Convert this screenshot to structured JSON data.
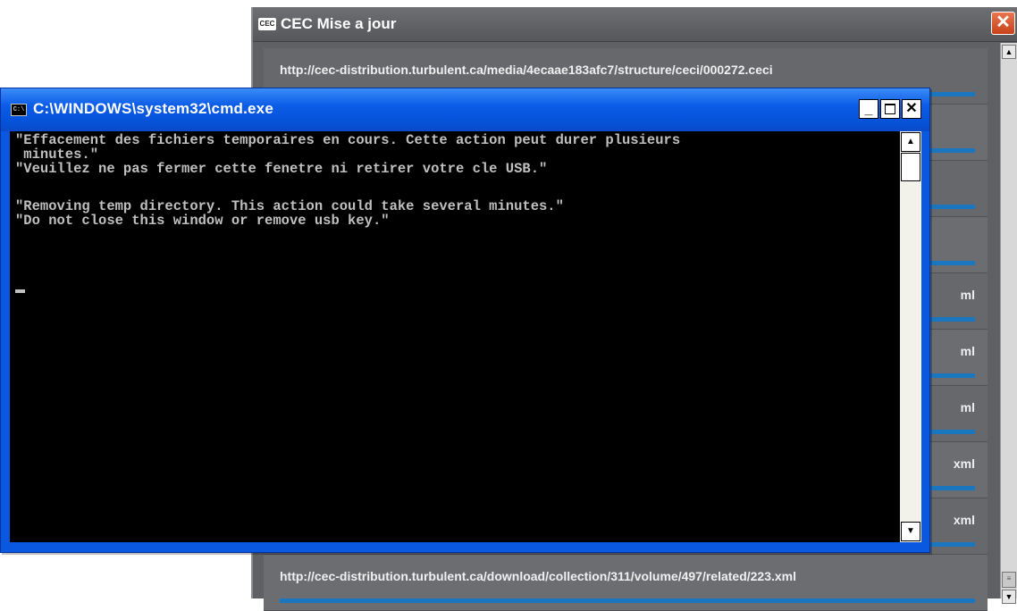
{
  "cec_window": {
    "logo_text": "CEC",
    "title": "CEC Mise a jour",
    "close_symbol": "✕",
    "rows": [
      {
        "label": "http://cec-distribution.turbulent.ca/media/4ecaae183afc7/structure/ceci/000272.ceci"
      },
      {
        "label": ""
      },
      {
        "label": ""
      },
      {
        "label": ""
      },
      {
        "label": "ml"
      },
      {
        "label": "ml"
      },
      {
        "label": "ml"
      },
      {
        "label": "xml"
      },
      {
        "label": "xml"
      },
      {
        "label": "http://cec-distribution.turbulent.ca/download/collection/311/volume/497/related/223.xml"
      }
    ],
    "scroll_up_icon": "▲",
    "scroll_down_icon": "▼",
    "scroll_thumb_icon": "≡"
  },
  "cmd_window": {
    "icon_text": "C:\\",
    "title": "C:\\WINDOWS\\system32\\cmd.exe",
    "minimize_symbol": "_",
    "close_symbol": "✕",
    "lines": [
      "\"Effacement des fichiers temporaires en cours. Cette action peut durer plusieurs",
      " minutes.\"",
      "\"Veuillez ne pas fermer cette fenetre ni retirer votre cle USB.\"",
      "",
      "\"Removing temp directory. This action could take several minutes.\"",
      "\"Do not close this window or remove usb key.\""
    ],
    "scroll_up_icon": "▲",
    "scroll_down_icon": "▼"
  }
}
